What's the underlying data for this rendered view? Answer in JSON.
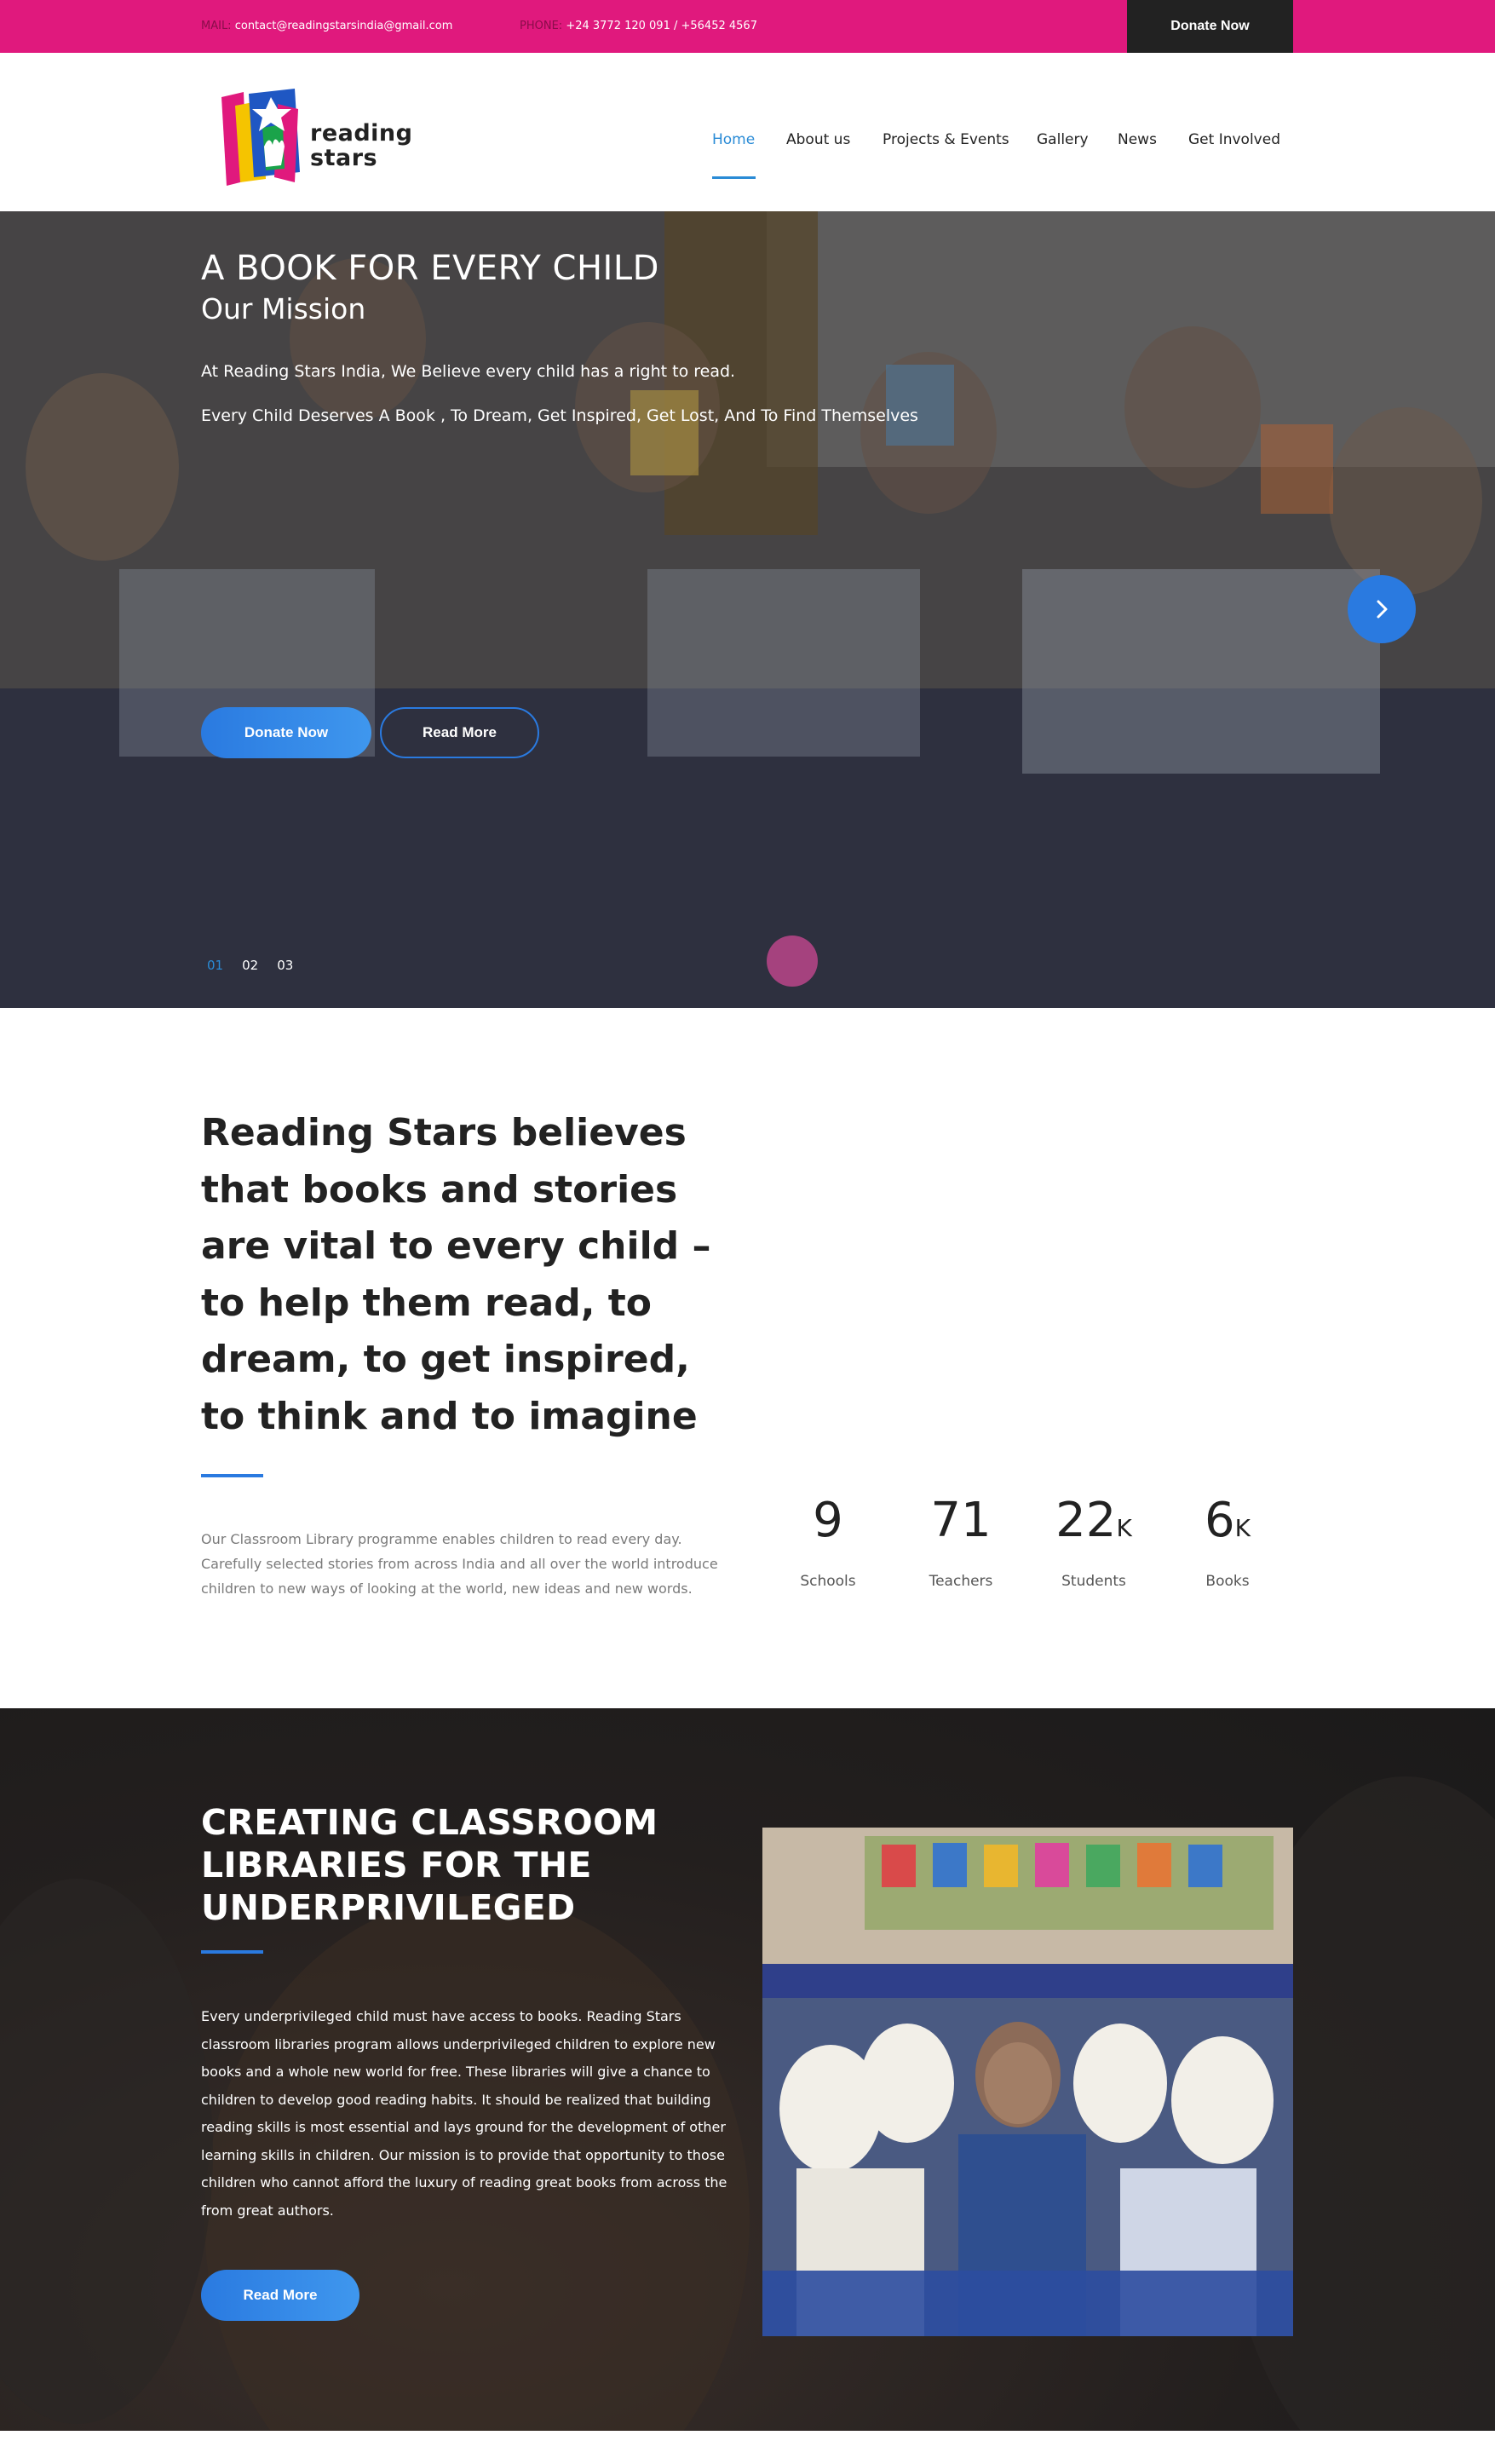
{
  "topbar": {
    "mail_label": "MAIL:",
    "mail_value": "contact@readingstarsindia@gmail.com",
    "phone_label": "PHONE:",
    "phone_value": "+24 3772 120 091 / +56452 4567",
    "donate_label": "Donate Now",
    "background_color": "#e0197d"
  },
  "header": {
    "logo_text_line1": "reading",
    "logo_text_line2": "stars",
    "nav": [
      {
        "label": "Home",
        "active": true
      },
      {
        "label": "About us",
        "active": false
      },
      {
        "label": "Projects & Events",
        "active": false
      },
      {
        "label": "Gallery",
        "active": false
      },
      {
        "label": "News",
        "active": false
      },
      {
        "label": "Get Involved",
        "active": false
      }
    ],
    "accent_color": "#2a8bd6"
  },
  "hero": {
    "title": "A BOOK FOR EVERY CHILD",
    "subtitle": "Our Mission",
    "line1": "At Reading Stars India, We Believe every child has a right to read.",
    "line2": "Every Child Deserves A Book , To Dream, Get Inspired, Get Lost, And To Find Themselves",
    "donate_label": "Donate Now",
    "read_more_label": "Read More",
    "next_icon": "chevron-right-icon",
    "slides": [
      "01",
      "02",
      "03"
    ],
    "active_slide": "01"
  },
  "about": {
    "heading": "Reading Stars believes that books and stories are vital to every child –to help them read, to dream, to get inspired, to think and to imagine",
    "text": "Our Classroom Library programme enables children to read every day. Carefully selected stories from across India and all over the world introduce children to new ways of looking at the world, new ideas and new words.",
    "stats": [
      {
        "value": "9",
        "suffix": "",
        "label": "Schools"
      },
      {
        "value": "71",
        "suffix": "",
        "label": "Teachers"
      },
      {
        "value": "22",
        "suffix": "K",
        "label": "Students"
      },
      {
        "value": "6",
        "suffix": "K",
        "label": "Books"
      }
    ]
  },
  "libraries": {
    "heading": "CREATING CLASSROOM LIBRARIES FOR THE UNDERPRIVILEGED",
    "text": "Every underprivileged child must have access to books. Reading Stars classroom libraries program allows underprivileged children to explore new books and a whole new world for free. These libraries will give a chance to children to develop good reading habits. It should be realized that building reading skills is most essential and lays ground for the development of other learning skills in children. Our mission is to provide that opportunity to those children who cannot afford the luxury of reading great books from across the from great authors.",
    "read_more_label": "Read More"
  },
  "colors": {
    "button_blue": "#2a7ae0",
    "dark_section": "#231f1e"
  }
}
